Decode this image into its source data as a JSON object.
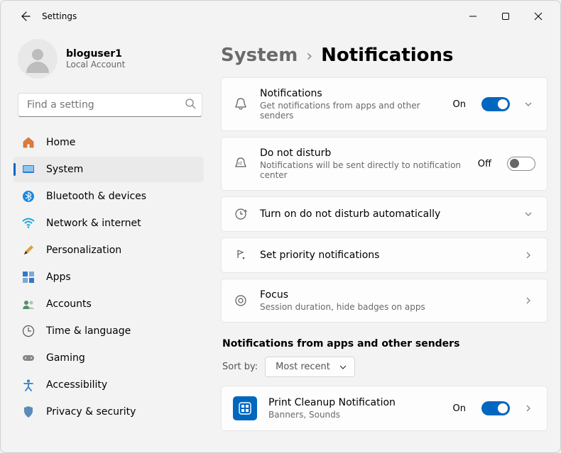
{
  "titlebar": {
    "app_title": "Settings"
  },
  "user": {
    "name": "bloguser1",
    "sub": "Local Account"
  },
  "search": {
    "placeholder": "Find a setting"
  },
  "sidebar": {
    "items": [
      {
        "label": "Home"
      },
      {
        "label": "System"
      },
      {
        "label": "Bluetooth & devices"
      },
      {
        "label": "Network & internet"
      },
      {
        "label": "Personalization"
      },
      {
        "label": "Apps"
      },
      {
        "label": "Accounts"
      },
      {
        "label": "Time & language"
      },
      {
        "label": "Gaming"
      },
      {
        "label": "Accessibility"
      },
      {
        "label": "Privacy & security"
      }
    ]
  },
  "breadcrumb": {
    "parent": "System",
    "sep": "›",
    "current": "Notifications"
  },
  "main": {
    "notifications": {
      "title": "Notifications",
      "sub": "Get notifications from apps and other senders",
      "state": "On"
    },
    "dnd": {
      "title": "Do not disturb",
      "sub": "Notifications will be sent directly to notification center",
      "state": "Off"
    },
    "dnd_auto": {
      "title": "Turn on do not disturb automatically"
    },
    "priority": {
      "title": "Set priority notifications"
    },
    "focus": {
      "title": "Focus",
      "sub": "Session duration, hide badges on apps"
    }
  },
  "section_heading": "Notifications from apps and other senders",
  "sort": {
    "label": "Sort by:",
    "value": "Most recent"
  },
  "app_row": {
    "title": "Print Cleanup Notification",
    "sub": "Banners, Sounds",
    "state": "On"
  }
}
